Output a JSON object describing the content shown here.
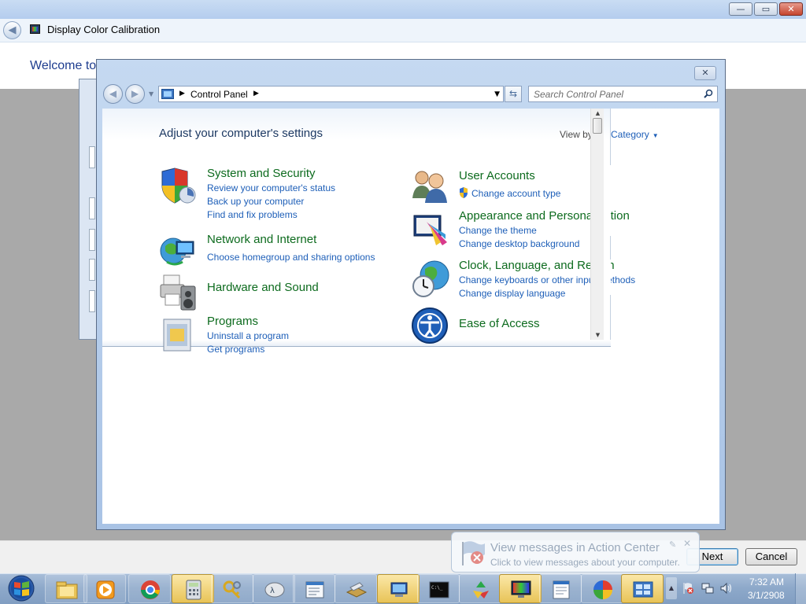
{
  "dcc": {
    "title": "Display Color Calibration",
    "welcome": "Welcome to",
    "next_label": "Next",
    "cancel_label": "Cancel",
    "window_controls": {
      "minimize": "—",
      "maximize": "▭",
      "close": "✕"
    }
  },
  "control_panel": {
    "address": {
      "root_label": "Control Panel"
    },
    "search_placeholder": "Search Control Panel",
    "heading": "Adjust your computer's settings",
    "view_by_label": "View by:",
    "view_by_value": "Category",
    "categories": [
      {
        "title": "System and Security",
        "icon": "shield-icon",
        "links": [
          "Review your computer's status",
          "Back up your computer",
          "Find and fix problems"
        ]
      },
      {
        "title": "Network and Internet",
        "icon": "network-globe-icon",
        "links": [
          "Choose homegroup and sharing options"
        ]
      },
      {
        "title": "Hardware and Sound",
        "icon": "printer-speaker-icon",
        "links": []
      },
      {
        "title": "Programs",
        "icon": "programs-icon",
        "links": [
          "Uninstall a program",
          "Get programs"
        ]
      },
      {
        "title": "User Accounts",
        "icon": "users-icon",
        "links": [
          "Change account type"
        ]
      },
      {
        "title": "Appearance and Personalization",
        "icon": "appearance-icon",
        "links": [
          "Change the theme",
          "Change desktop background"
        ]
      },
      {
        "title": "Clock, Language, and Region",
        "icon": "clock-globe-icon",
        "links": [
          "Change keyboards or other input methods",
          "Change display language"
        ]
      },
      {
        "title": "Ease of Access",
        "icon": "ease-of-access-icon",
        "links": []
      }
    ]
  },
  "balloon": {
    "title": "View messages in Action Center",
    "text": "Click to view messages about your computer."
  },
  "taskbar": {
    "time": "7:32 AM",
    "date": "3/1/2908",
    "items": [
      "start-orb-icon",
      "explorer-icon",
      "media-player-icon",
      "chrome-icon",
      "calculator-icon",
      "keys-icon",
      "app-icon",
      "notepad-icon",
      "scanner-icon",
      "network-manager-icon",
      "command-prompt-icon",
      "recycle-icon",
      "monitor-icon",
      "document-icon",
      "color-ball-icon",
      "control-panel-icon"
    ]
  },
  "colors": {
    "category_green": "#0d6b1e",
    "link_blue": "#1e5fb8",
    "heading_blue": "#1e3a63"
  }
}
